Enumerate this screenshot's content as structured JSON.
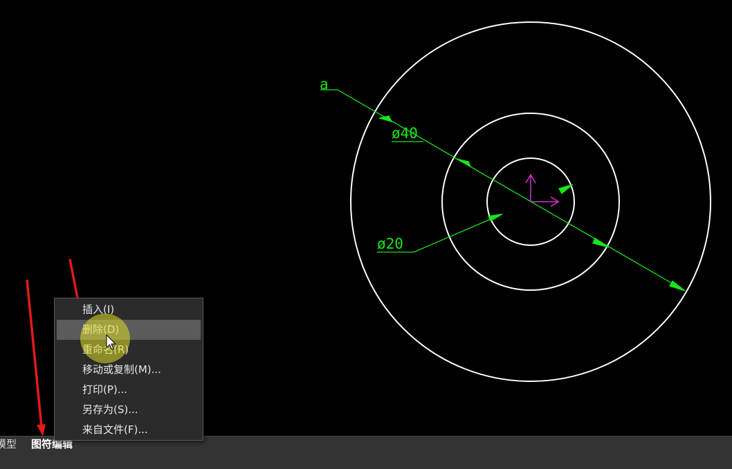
{
  "drawing": {
    "dimension_leader_label": "a",
    "dim_large": "ø40",
    "dim_small": "ø20"
  },
  "context_menu": {
    "items": [
      {
        "label": "插入(I)"
      },
      {
        "label": "删除(D)"
      },
      {
        "label": "重命名(R)"
      },
      {
        "label": "移动或复制(M)..."
      },
      {
        "label": "打印(P)..."
      },
      {
        "label": "另存为(S)..."
      },
      {
        "label": "来自文件(F)..."
      }
    ],
    "hovered_index": 1
  },
  "tabs": {
    "model": "模型",
    "layout": "图符编辑"
  },
  "colors": {
    "canvas": "#000000",
    "circles": "#ffffff",
    "dimension": "#19e619",
    "ucs_icon": "#d633d6",
    "annotation_arrow": "#e11a1a",
    "cursor_highlight": "#dcdc28"
  }
}
